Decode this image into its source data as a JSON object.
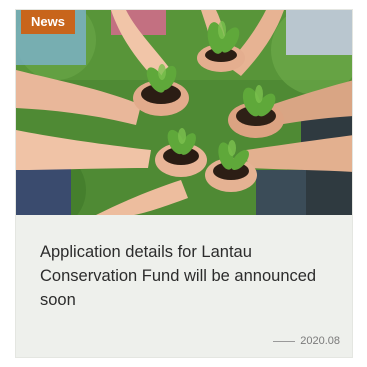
{
  "card": {
    "tag_label": "News",
    "title": "Application details for Lantau Conservation Fund will be announced soon",
    "date": "2020.08",
    "image_alt_icon": "seedlings-in-hands-photo"
  },
  "colors": {
    "tag_background": "#c8651b",
    "card_background": "#eef0ec",
    "title_text": "#2c2c2c",
    "date_text": "#7a7a7a"
  }
}
